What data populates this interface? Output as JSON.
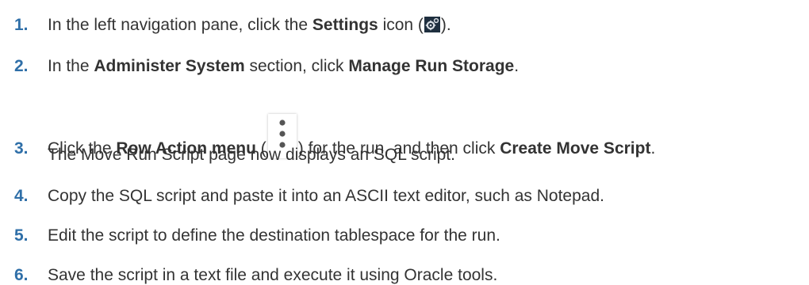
{
  "steps": [
    {
      "num": "1.",
      "pre": "In the left navigation pane, click the ",
      "bold1": "Settings",
      "mid": " icon (",
      "post": ")."
    },
    {
      "num": "2.",
      "pre": "In the ",
      "bold1": "Administer System",
      "mid": " section, click ",
      "bold2": "Manage Run Storage",
      "post": "."
    },
    {
      "num": "3.",
      "pre": "Click the ",
      "bold1": "Row Action menu",
      "mid": " (",
      "mid2": ") for the run, and then click ",
      "bold2": "Create Move Script",
      "post": ".",
      "sub": "The Move Run Script page now displays an SQL script."
    },
    {
      "num": "4.",
      "text": "Copy the SQL script and paste it into an ASCII text editor, such as Notepad."
    },
    {
      "num": "5.",
      "text": "Edit the script to define the destination tablespace for the run."
    },
    {
      "num": "6.",
      "text": "Save the script in a text file and execute it using Oracle tools."
    }
  ],
  "icons": {
    "settings": "gear-icon",
    "row_action": "vertical-ellipsis-icon"
  },
  "colors": {
    "step_number": "#2f6fa8",
    "body_text": "#333333"
  }
}
